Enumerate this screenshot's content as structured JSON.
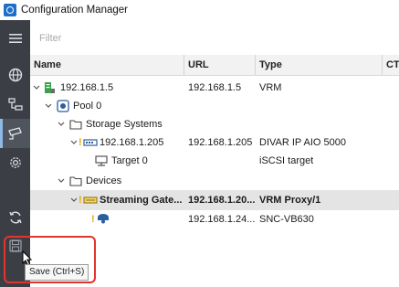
{
  "window": {
    "title": "Configuration Manager"
  },
  "filter": {
    "placeholder": "Filter",
    "value": ""
  },
  "columns": [
    "Name",
    "URL",
    "Type",
    "CTI"
  ],
  "rows": [
    {
      "name": "192.168.1.5",
      "url": "192.168.1.5",
      "type": "VRM",
      "icon": "vrm-server-icon",
      "expanded": true
    },
    {
      "name": "Pool 0",
      "url": "",
      "type": "",
      "icon": "pool-icon",
      "expanded": true
    },
    {
      "name": "Storage Systems",
      "url": "",
      "type": "",
      "icon": "folder-icon",
      "expanded": true
    },
    {
      "name": "192.168.1.205",
      "url": "192.168.1.205",
      "type": "DIVAR IP AIO 5000",
      "icon": "storage-device-icon",
      "expanded": true,
      "warning": "!"
    },
    {
      "name": "Target 0",
      "url": "",
      "type": "iSCSI target",
      "icon": "target-icon"
    },
    {
      "name": "Devices",
      "url": "",
      "type": "",
      "icon": "folder-icon",
      "expanded": true
    },
    {
      "name": "Streaming Gate...",
      "url": "192.168.1.20...",
      "type": "VRM Proxy/1",
      "icon": "streaming-gateway-icon",
      "expanded": true,
      "warning": "!",
      "selected": true
    },
    {
      "name": "",
      "url": "192.168.1.24...",
      "type": "SNC-VB630",
      "icon": "camera-icon",
      "warning": "!"
    }
  ],
  "save": {
    "tooltip": "Save (Ctrl+S)"
  },
  "colors": {
    "nav_bg": "#3b3f45",
    "highlight": "#e2342f",
    "selection": "#e4e4e4",
    "warning": "#e0a800"
  }
}
